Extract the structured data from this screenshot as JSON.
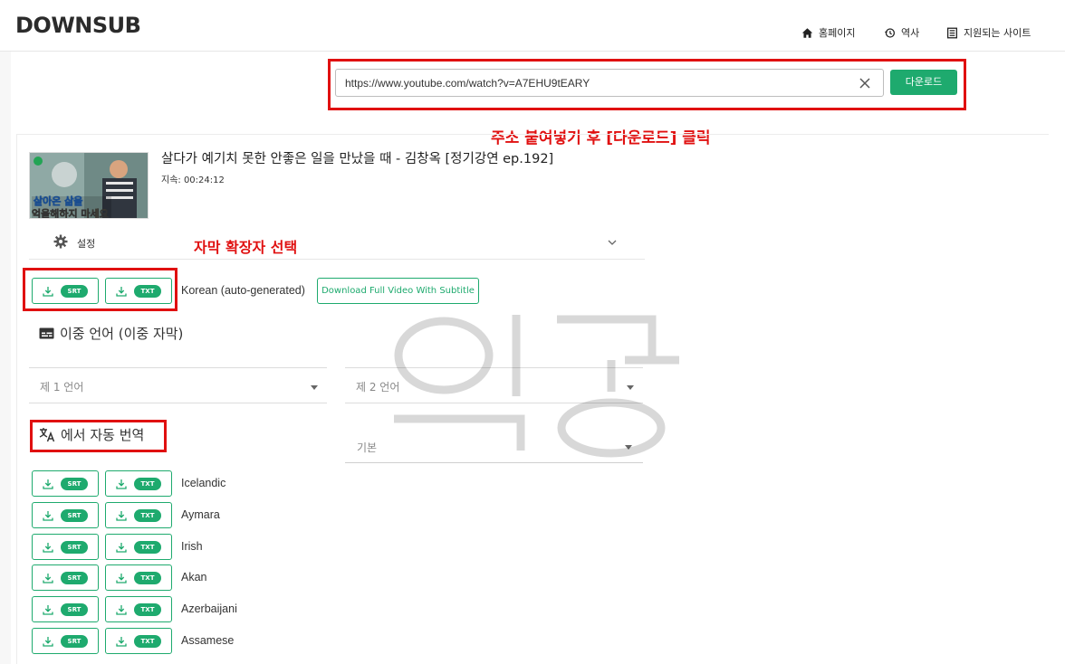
{
  "header": {
    "logo": "DOWNSUB",
    "nav": [
      {
        "label": "홈페이지",
        "icon": "home-icon"
      },
      {
        "label": "역사",
        "icon": "history-icon"
      },
      {
        "label": "지원되는 사이트",
        "icon": "list-icon"
      }
    ]
  },
  "search": {
    "value": "https://www.youtube.com/watch?v=A7EHU9tEARY",
    "download_label": "다운로드"
  },
  "annotations": {
    "paste_hint": "주소 붙여넣기 후 [다운로드] 클릭",
    "format_hint": "자막 확장자 선택"
  },
  "video": {
    "title": "살다가 예기치 못한 안좋은 일을 만났을 때 - 김창옥 [정기강연 ep.192]",
    "duration": "지속: 00:24:12",
    "thumbnail_caption": [
      "살아온 삶을",
      "억울해하지 마세요"
    ]
  },
  "settings": {
    "label": "설정"
  },
  "formats": {
    "srt": "SRT",
    "txt": "TXT"
  },
  "original_track": {
    "language": "Korean (auto-generated)",
    "full_video_label": "Download Full Video With Subtitle"
  },
  "dual_language": {
    "title": "이중 언어 (이중 자막)",
    "lang1_placeholder": "제 1 언어",
    "lang2_placeholder": "제 2 언어"
  },
  "auto_translate": {
    "title": "에서 자동 번역",
    "source_placeholder": "기본"
  },
  "languages": [
    "Icelandic",
    "Aymara",
    "Irish",
    "Akan",
    "Azerbaijani",
    "Assamese"
  ],
  "colors": {
    "accent": "#1eaa6e",
    "annotation": "#e01010"
  },
  "watermark": "익꿍"
}
